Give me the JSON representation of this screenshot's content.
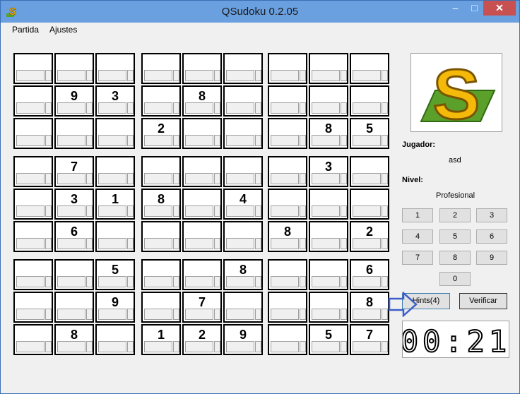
{
  "window": {
    "title": "QSudoku 0.2.05",
    "buttons": {
      "minimize": "–",
      "maximize": "□",
      "close": "✕"
    }
  },
  "menu": [
    "Partida",
    "Ajustes"
  ],
  "board": [
    [
      "",
      "",
      "",
      "",
      "",
      "",
      "",
      "",
      ""
    ],
    [
      "",
      "9",
      "3",
      "",
      "8",
      "",
      "",
      "",
      ""
    ],
    [
      "",
      "",
      "",
      "2",
      "",
      "",
      "",
      "8",
      "5"
    ],
    [
      "",
      "7",
      "",
      "",
      "",
      "",
      "",
      "3",
      ""
    ],
    [
      "",
      "3",
      "1",
      "8",
      "",
      "4",
      "",
      "",
      ""
    ],
    [
      "",
      "6",
      "",
      "",
      "",
      "",
      "8",
      "",
      "2"
    ],
    [
      "",
      "",
      "5",
      "",
      "",
      "8",
      "",
      "",
      "6"
    ],
    [
      "",
      "",
      "9",
      "",
      "7",
      "",
      "",
      "",
      "8"
    ],
    [
      "",
      "8",
      "",
      "1",
      "2",
      "9",
      "",
      "5",
      "7"
    ]
  ],
  "sidebar": {
    "player_label": "Jugador:",
    "player_name": "asd",
    "level_label": "Nivel:",
    "level_value": "Profesional",
    "numbers": [
      "1",
      "2",
      "3",
      "4",
      "5",
      "6",
      "7",
      "8",
      "9",
      "0"
    ],
    "hints_label": "Hints(4)",
    "verify_label": "Verificar",
    "timer": "00:21"
  },
  "colors": {
    "titlebar": "#6aa0e0",
    "close": "#c75050",
    "logo_yellow": "#f5b90a",
    "logo_green": "#5aa02a",
    "arrow": "#3c5fc8"
  }
}
